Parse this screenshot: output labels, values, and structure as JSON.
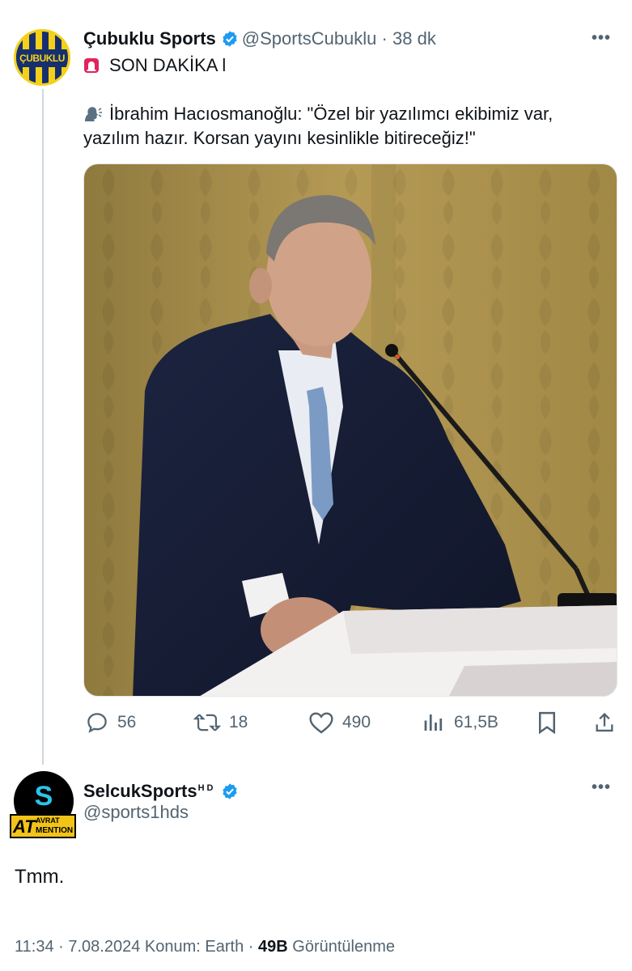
{
  "tweet": {
    "author_name": "Çubuklu Sports",
    "author_handle": "@SportsCubuklu",
    "separator": "·",
    "time_ago": "38 dk",
    "avatar_text": "ÇUBUKLU",
    "line1": "SON DAKİKA l",
    "line2": "İbrahim Hacıosmanoğlu: \"Özel bir yazılımcı ekibimiz var,",
    "line3": "yazılım hazır. Korsan yayını kesinlikle bitireceğiz!\"",
    "icons": [
      "siren-emoji",
      "speaking-head-emoji",
      "verified-badge",
      "more-icon"
    ],
    "image": "photo of a man in a navy suit speaking at a white podium with a microphone",
    "stats": {
      "replies": "56",
      "retweets": "18",
      "likes": "490",
      "views": "61,5B"
    },
    "action_icons": [
      "reply-icon",
      "retweet-icon",
      "like-icon",
      "views-icon",
      "bookmark-icon",
      "share-icon"
    ]
  },
  "reply": {
    "author_name": "SelcukSports",
    "hd": "HD",
    "author_handle": "@sports1hds",
    "badge_at": "AT",
    "badge_line1": "AVRAT",
    "badge_line2": "MENTION",
    "text": "Tmm.",
    "time": "11:34",
    "date": "7.08.2024",
    "location": "Konum: Earth",
    "views_count": "49B",
    "views_label": "Görüntülenme",
    "separator": "·"
  },
  "colors": {
    "text": "#0f1419",
    "secondary": "#536471",
    "verified": "#1d9bf0",
    "thread_line": "#cfd9de"
  }
}
